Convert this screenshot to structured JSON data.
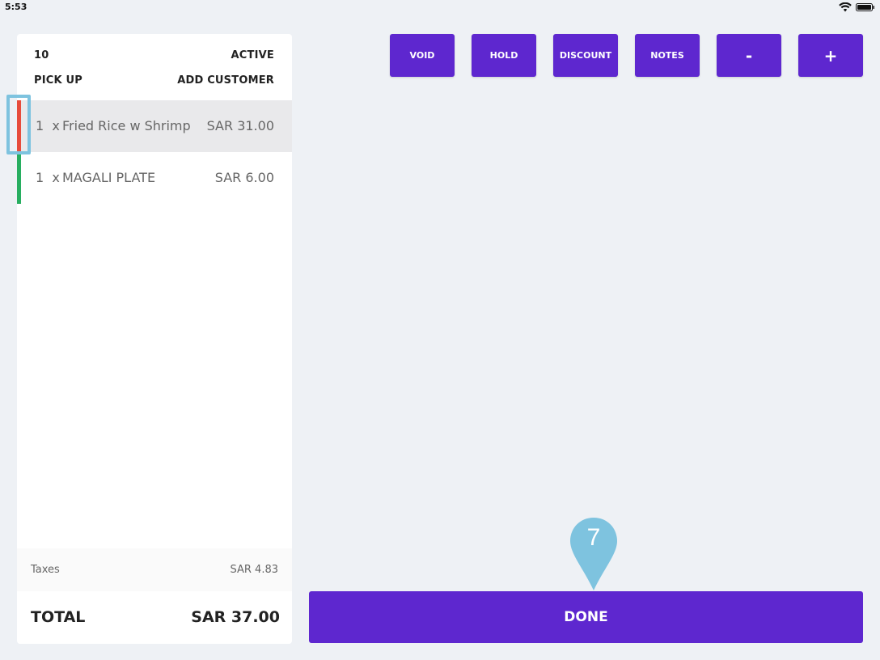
{
  "status_bar": {
    "time": "5:53",
    "wifi_icon": "wifi-icon",
    "battery_icon": "battery-icon"
  },
  "order": {
    "number": "10",
    "status": "ACTIVE",
    "type": "PICK UP",
    "add_customer": "ADD CUSTOMER",
    "items": [
      {
        "qty": "1",
        "sep": "x",
        "name": "Fried Rice w Shrimp",
        "price": "SAR 31.00",
        "status_color": "#e74c3c",
        "selected": true
      },
      {
        "qty": "1",
        "sep": "x",
        "name": "MAGALI PLATE",
        "price": "SAR 6.00",
        "status_color": "#27ae60",
        "selected": false
      }
    ],
    "taxes_label": "Taxes",
    "taxes_value": "SAR 4.83",
    "total_label": "TOTAL",
    "total_value": "SAR 37.00"
  },
  "actions": {
    "void": "VOID",
    "hold": "HOLD",
    "discount": "DISCOUNT",
    "notes": "NOTES",
    "minus": "-",
    "plus": "+"
  },
  "done_label": "DONE",
  "step_marker": "7",
  "colors": {
    "accent": "#5e27cf",
    "background": "#eef1f5",
    "marker": "#7ec3df"
  }
}
